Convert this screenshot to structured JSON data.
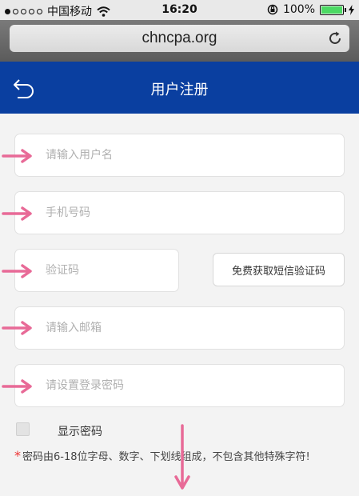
{
  "status_bar": {
    "carrier": "中国移动",
    "time": "16:20",
    "battery_percent": "100%"
  },
  "browser": {
    "url": "chncpa.org"
  },
  "header": {
    "title": "用户注册"
  },
  "form": {
    "username_placeholder": "请输入用户名",
    "phone_placeholder": "手机号码",
    "code_placeholder": "验证码",
    "sms_button_label": "免费获取短信验证码",
    "email_placeholder": "请输入邮箱",
    "password_placeholder": "请设置登录密码",
    "show_password_label": "显示密码",
    "password_hint_star": "*",
    "password_hint": "密码由6-18位字母、数字、下划线组成，不包含其他特殊字符!"
  },
  "colors": {
    "header_bg": "#0a3fa0",
    "arrow_pink": "#e86a97",
    "hint_star": "#e33333",
    "battery_green": "#4cd964"
  },
  "icons": [
    "signal-dots-icon",
    "wifi-icon",
    "orientation-lock-icon",
    "battery-icon",
    "charging-icon",
    "reload-icon",
    "back-icon",
    "arrow-annotation-icon",
    "down-arrow-annotation-icon"
  ]
}
